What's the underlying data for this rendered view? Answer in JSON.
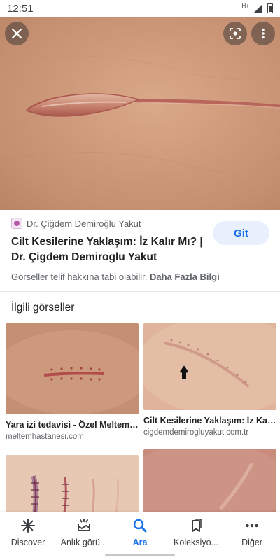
{
  "status_bar": {
    "time": "12:51",
    "network": "H+"
  },
  "colors": {
    "accent": "#1a73e8",
    "accent_bg": "#e8f0fe",
    "skin": "#cf9a7b",
    "scar": "#b8665b"
  },
  "hero": {
    "close_icon": "close-icon",
    "lens_icon": "lens-icon",
    "more_icon": "more-vert-icon"
  },
  "result": {
    "source_name": "Dr. Çiğdem Demiroğlu Yakut",
    "visit_label": "Git",
    "title": "Cilt Kesilerine Yaklaşım: İz Kalır Mı? | Dr. Çigdem Demiroglu Yakut",
    "copyright_text": "Görseller telif hakkına tabi olabilir.",
    "more_info_label": "Daha Fazla Bilgi"
  },
  "related": {
    "heading": "İlgili görseller",
    "items": [
      {
        "title": "Yara izi tedavisi - Özel Meltem Hastanesi",
        "domain": "meltemhastanesi.com"
      },
      {
        "title": "Cilt Kesilerine Yaklaşım: İz Kalır Mı?",
        "domain": "cigdemdemirogluyakut.com.tr"
      },
      {
        "title": "",
        "domain": ""
      },
      {
        "title": "",
        "domain": ""
      }
    ]
  },
  "bottom_nav": {
    "items": [
      {
        "label": "Discover",
        "icon": "asterisk-icon"
      },
      {
        "label": "Anlık görü...",
        "icon": "snapshot-icon"
      },
      {
        "label": "Ara",
        "icon": "search-icon"
      },
      {
        "label": "Koleksiyo...",
        "icon": "collections-icon"
      },
      {
        "label": "Diğer",
        "icon": "more-horiz-icon"
      }
    ],
    "active_index": 2
  }
}
